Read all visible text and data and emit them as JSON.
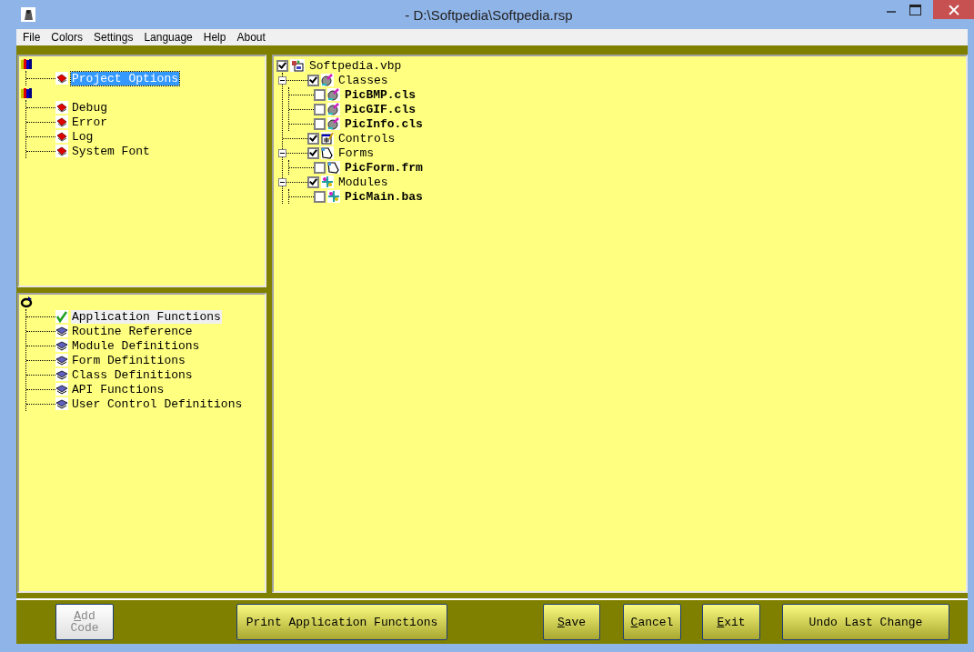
{
  "window": {
    "title": "- D:\\Softpedia\\Softpedia.rsp"
  },
  "menu": [
    "File",
    "Colors",
    "Settings",
    "Language",
    "Help",
    "About"
  ],
  "options_tree": {
    "focused": true,
    "roots": [
      {
        "kind": "books",
        "children": [
          {
            "label": "Project Options",
            "kind": "book",
            "selected": true
          }
        ]
      },
      {
        "kind": "books",
        "children": [
          {
            "label": "Debug",
            "kind": "book",
            "selected": false
          },
          {
            "label": "Error",
            "kind": "book",
            "selected": false
          },
          {
            "label": "Log",
            "kind": "book",
            "selected": false
          },
          {
            "label": "System Font",
            "kind": "book",
            "selected": false
          }
        ]
      }
    ]
  },
  "functions_tree": {
    "focused": false,
    "roots": [
      {
        "kind": "link",
        "children": [
          {
            "label": "Application Functions",
            "kind": "check",
            "selected": true
          },
          {
            "label": "Routine Reference",
            "kind": "printer",
            "selected": false
          },
          {
            "label": "Module Definitions",
            "kind": "printer",
            "selected": false
          },
          {
            "label": "Form Definitions",
            "kind": "printer",
            "selected": false
          },
          {
            "label": "Class Definitions",
            "kind": "printer",
            "selected": false
          },
          {
            "label": "API Functions",
            "kind": "printer",
            "selected": false
          },
          {
            "label": "User Control Definitions",
            "kind": "printer",
            "selected": false
          }
        ]
      }
    ]
  },
  "project_tree": {
    "root": {
      "label": "Softpedia.vbp",
      "kind": "project",
      "checked": true,
      "children": [
        {
          "label": "Classes",
          "kind": "class",
          "checked": true,
          "expanded": true,
          "children": [
            {
              "label": "PicBMP.cls",
              "kind": "class",
              "checked": false
            },
            {
              "label": "PicGIF.cls",
              "kind": "class",
              "checked": false
            },
            {
              "label": "PicInfo.cls",
              "kind": "class",
              "checked": false
            }
          ]
        },
        {
          "label": "Controls",
          "kind": "controls",
          "checked": true
        },
        {
          "label": "Forms",
          "kind": "form",
          "checked": true,
          "expanded": true,
          "children": [
            {
              "label": "PicForm.frm",
              "kind": "form",
              "checked": false
            }
          ]
        },
        {
          "label": "Modules",
          "kind": "module",
          "checked": true,
          "expanded": true,
          "children": [
            {
              "label": "PicMain.bas",
              "kind": "module",
              "checked": false
            }
          ]
        }
      ]
    }
  },
  "buttons": [
    {
      "label": "Add Code",
      "underline_first": true,
      "disabled": true
    },
    {
      "label": "Print Application Functions",
      "underline_first": false,
      "disabled": false
    },
    {
      "label": "Save",
      "underline_first": true,
      "disabled": false
    },
    {
      "label": "Cancel",
      "underline_first": true,
      "disabled": false
    },
    {
      "label": "Exit",
      "underline_first": true,
      "disabled": false
    },
    {
      "label": "Undo Last Change",
      "underline_first": false,
      "disabled": false
    }
  ]
}
